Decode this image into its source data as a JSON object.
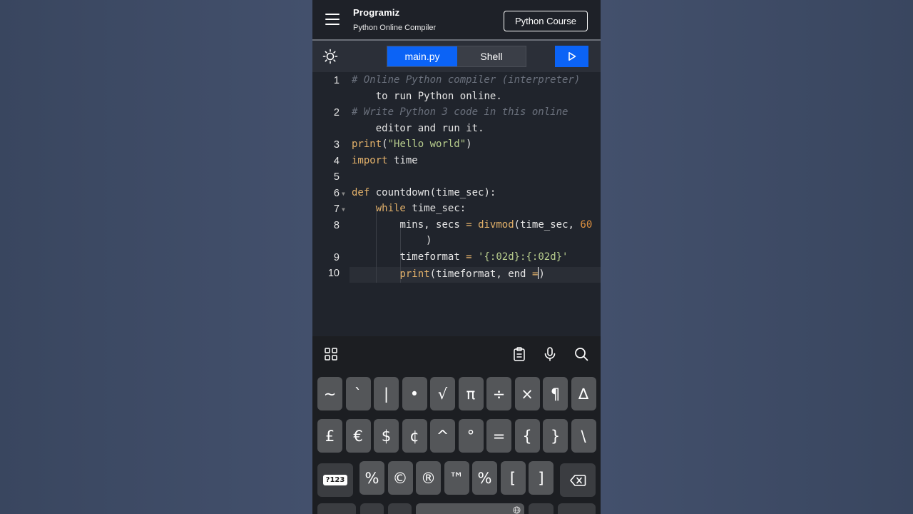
{
  "header": {
    "logo": "Programiz",
    "subtitle": "Python Online Compiler",
    "course_button": "Python Course"
  },
  "toolbar": {
    "tabs": [
      {
        "label": "main.py",
        "active": true
      },
      {
        "label": "Shell",
        "active": false
      }
    ],
    "theme_icon": "sun-icon",
    "run_icon": "play-icon"
  },
  "editor": {
    "lines": [
      {
        "n": "1",
        "fold": false,
        "wrap": [
          "# Online Python compiler (interpreter)",
          "    to run Python online."
        ]
      },
      {
        "n": "2",
        "fold": false,
        "wrap": [
          "# Write Python 3 code in this online",
          "    editor and run it."
        ]
      },
      {
        "n": "3",
        "fold": false,
        "code": "print(\"Hello world\")"
      },
      {
        "n": "4",
        "fold": false,
        "code": "import time"
      },
      {
        "n": "5",
        "fold": false,
        "code": ""
      },
      {
        "n": "6",
        "fold": true,
        "code": "def countdown(time_sec):"
      },
      {
        "n": "7",
        "fold": true,
        "code": "    while time_sec:"
      },
      {
        "n": "8",
        "fold": false,
        "code": "        mins, secs = divmod(time_sec, 60",
        "continuation": ")"
      },
      {
        "n": "9",
        "fold": false,
        "code": "        timeformat = '{:02d}:{:02d}'"
      },
      {
        "n": "10",
        "fold": false,
        "code": "        print(timeformat, end =)"
      }
    ],
    "colors": {
      "keyword": "#e3b16a",
      "comment": "#6a707c",
      "string": "#b9ce8e",
      "number": "#e0913f"
    }
  },
  "keyboard": {
    "toolbar_icons": [
      "apps-grid-icon",
      "clipboard-icon",
      "microphone-icon",
      "search-icon"
    ],
    "row1": [
      "~",
      "`",
      "|",
      "•",
      "√",
      "π",
      "÷",
      "×",
      "¶",
      "∆"
    ],
    "row2": [
      "£",
      "€",
      "$",
      "¢",
      "^",
      "°",
      "=",
      "{",
      "}",
      "\\"
    ],
    "row3": [
      "%",
      "©",
      "®",
      "™",
      "%",
      "[",
      "]"
    ],
    "mode_key": "?123",
    "delete_icon": "backspace-icon",
    "bottom_icon": "globe-icon"
  },
  "accent": "#0b63f6"
}
